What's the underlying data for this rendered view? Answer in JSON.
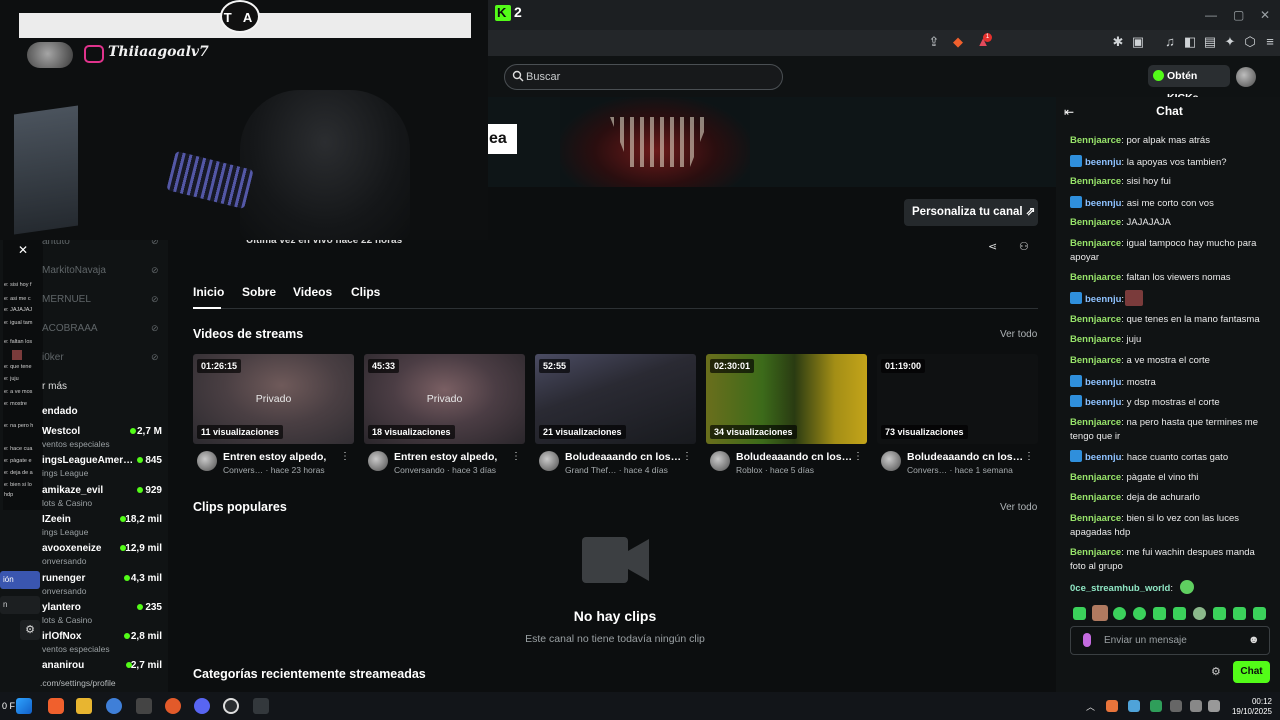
{
  "browser": {
    "tab_count_label": "2",
    "toolbar_icons": [
      "share-icon",
      "brave-shield-icon",
      "rewards-icon",
      "extensions-icon",
      "reader-icon",
      "music-icon",
      "sidebar-icon",
      "wallet-icon",
      "leo-icon",
      "vpn-icon",
      "menu-icon"
    ],
    "notification_badge": "1"
  },
  "header": {
    "search_placeholder": "Buscar",
    "get_kicks_label": "Obtén KICKs"
  },
  "banner": {
    "partial_text": "ea"
  },
  "channel": {
    "last_live": "Última vez en vivo hace 22 horas",
    "customize_label": "Personaliza tu canal",
    "tabs": [
      "Inicio",
      "Sobre",
      "Videos",
      "Clips"
    ],
    "streams_title": "Videos de streams",
    "see_all": "Ver todo",
    "videos": [
      {
        "duration": "01:26:15",
        "views": "11 visualizaciones",
        "private": "Privado",
        "title": "Entren estoy alpedo,",
        "meta": "Convers… · hace 23 horas"
      },
      {
        "duration": "45:33",
        "views": "18 visualizaciones",
        "private": "Privado",
        "title": "Entren estoy alpedo,",
        "meta": "Conversando · hace 3 días"
      },
      {
        "duration": "52:55",
        "views": "21 visualizaciones",
        "private": "",
        "title": "Boludeaaando cn los…",
        "meta": "Grand Thef… · hace 4 días"
      },
      {
        "duration": "02:30:01",
        "views": "34 visualizaciones",
        "private": "",
        "title": "Boludeaaando cn los…",
        "meta": "Roblox · hace 5 días"
      },
      {
        "duration": "01:19:00",
        "views": "73 visualizaciones",
        "private": "",
        "title": "Boludeaaando cn los…",
        "meta": "Convers… · hace 1 semana"
      }
    ],
    "clips_title": "Clips populares",
    "clips_see_all": "Ver todo",
    "no_clips": "No hay clips",
    "no_clips_sub": "Este canal no tiene todavía ningún clip",
    "categories_title": "Categorías recientemente streameadas"
  },
  "sidebar": {
    "offline": [
      "antuto",
      "MarkitoNavaja",
      "MERNUEL",
      "ACOBRAAA",
      "i0ker"
    ],
    "show_more": "r más",
    "recommended_label": "endado",
    "live": [
      {
        "name": "Westcol",
        "category": "ventos especiales",
        "viewers": "2,7 M"
      },
      {
        "name": "ingsLeagueAmer…",
        "category": "ings League",
        "viewers": "845"
      },
      {
        "name": "amikaze_evil",
        "category": "lots & Casino",
        "viewers": "929"
      },
      {
        "name": "IZeein",
        "category": "ings League",
        "viewers": "18,2 mil"
      },
      {
        "name": "avooxeneize",
        "category": "onversando",
        "viewers": "12,9 mil"
      },
      {
        "name": "runenger",
        "category": "onversando",
        "viewers": "4,3 mil"
      },
      {
        "name": "ylantero",
        "category": "lots & Casino",
        "viewers": "235"
      },
      {
        "name": "irlOfNox",
        "category": "ventos especiales",
        "viewers": "2,8 mil"
      },
      {
        "name": "ananirou",
        "category": "",
        "viewers": "2,7 mil"
      }
    ],
    "mini_chat": [
      "e: sisi hoy f",
      "e: asi me c",
      "e: JAJAJAJ",
      "e: igual tam",
      "e: faltan los",
      "e: que tene",
      "e: juju",
      "e: a ve mos",
      "e: mostre",
      "e: na pero h",
      "e: hace cua",
      "e: pàgate e",
      "e: deja de a",
      "e: bien si lo",
      "hdp"
    ],
    "mini_buttons": [
      "ión",
      "n"
    ],
    "settings_url": ".com/settings/profile"
  },
  "overlay": {
    "logo_text": "T A",
    "instagram_handle": "Thiiaagoalv7"
  },
  "chat": {
    "title": "Chat",
    "messages": [
      {
        "user": "Bennjaarce",
        "type": "u1",
        "text": "por alpak mas atrás"
      },
      {
        "user": "beennju",
        "type": "u2",
        "text": "la apoyas vos tambien?"
      },
      {
        "user": "Bennjaarce",
        "type": "u1",
        "text": "sisi hoy fui"
      },
      {
        "user": "beennju",
        "type": "u2",
        "text": "asi me corto con vos"
      },
      {
        "user": "Bennjaarce",
        "type": "u1",
        "text": "JAJAJAJA"
      },
      {
        "user": "Bennjaarce",
        "type": "u1",
        "text": "igual tampoco hay mucho para apoyar"
      },
      {
        "user": "Bennjaarce",
        "type": "u1",
        "text": "faltan los viewers nomas"
      },
      {
        "user": "beennju",
        "type": "u2",
        "text": ""
      },
      {
        "user": "Bennjaarce",
        "type": "u1",
        "text": "que tenes en la mano fantasma"
      },
      {
        "user": "Bennjaarce",
        "type": "u1",
        "text": "juju"
      },
      {
        "user": "Bennjaarce",
        "type": "u1",
        "text": "a ve mostra el corte"
      },
      {
        "user": "beennju",
        "type": "u2",
        "text": "mostra"
      },
      {
        "user": "beennju",
        "type": "u2",
        "text": "y dsp mostras el corte"
      },
      {
        "user": "Bennjaarce",
        "type": "u1",
        "text": "na pero hasta que termines me tengo que ir"
      },
      {
        "user": "beennju",
        "type": "u2",
        "text": "hace cuanto cortas gato"
      },
      {
        "user": "Bennjaarce",
        "type": "u1",
        "text": "pàgate el vino thi"
      },
      {
        "user": "Bennjaarce",
        "type": "u1",
        "text": "deja de achurarlo"
      },
      {
        "user": "Bennjaarce",
        "type": "u1",
        "text": "bien si lo vez con las luces apagadas hdp"
      },
      {
        "user": "Bennjaarce",
        "type": "u1",
        "text": "me fui wachin despues manda foto al grupo"
      },
      {
        "user": "0ce_streamhub_world",
        "type": "u3",
        "text": ""
      }
    ],
    "input_placeholder": "Enviar un mensaje",
    "send_label": "Chat"
  },
  "taskbar": {
    "time": "00:12",
    "date": "19/10/2025",
    "left_text": "0 F"
  }
}
